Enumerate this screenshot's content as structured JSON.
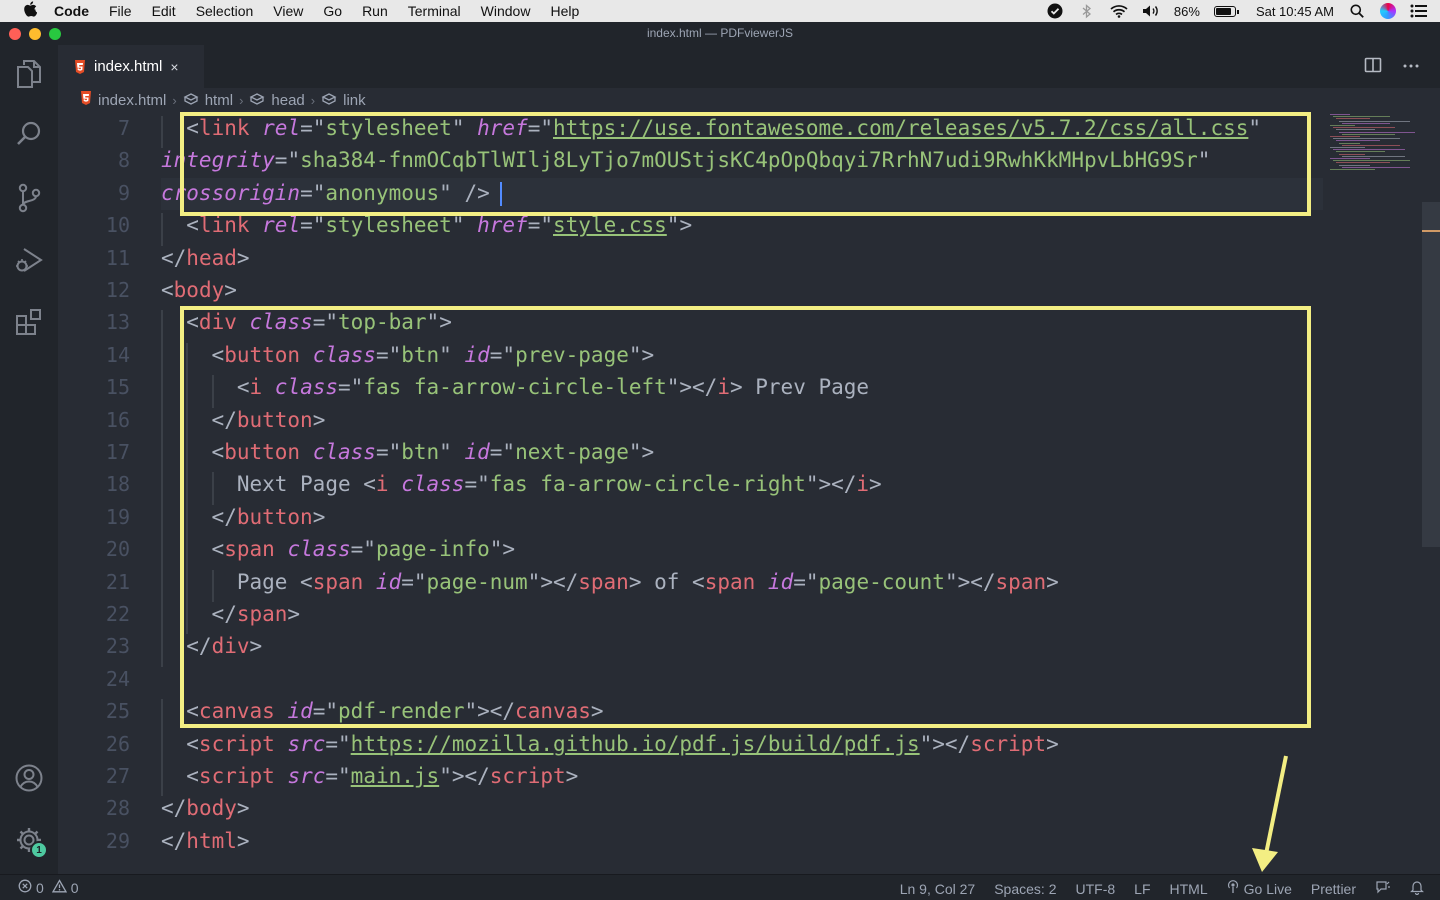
{
  "menubar": {
    "app": "Code",
    "items": [
      "File",
      "Edit",
      "Selection",
      "View",
      "Go",
      "Run",
      "Terminal",
      "Window",
      "Help"
    ],
    "battery": "86%",
    "battery_level": 0.86,
    "clock": "Sat 10:45 AM",
    "icons": [
      "apple-icon",
      "checkmark-circle-icon",
      "bluetooth-icon",
      "wifi-icon",
      "volume-icon",
      "battery-icon",
      "spotlight-search-icon",
      "siri-icon",
      "notification-center-icon"
    ]
  },
  "window": {
    "title": "index.html — PDFviewerJS"
  },
  "activity_bar": {
    "icons": [
      "explorer-icon",
      "search-icon",
      "source-control-icon",
      "run-debug-icon",
      "extensions-icon",
      "accounts-icon",
      "manage-gear-icon"
    ],
    "manage_badge": "1"
  },
  "tab": {
    "label": "index.html",
    "close": "×"
  },
  "breadcrumb": [
    "index.html",
    "html",
    "head",
    "link"
  ],
  "editor": {
    "line_numbers": [
      "7",
      "8",
      "9",
      "10",
      "11",
      "12",
      "13",
      "14",
      "15",
      "16",
      "17",
      "18",
      "19",
      "20",
      "21",
      "22",
      "23",
      "24",
      "25",
      "26",
      "27",
      "28",
      "29"
    ],
    "lines": [
      [
        [
          "p",
          "<"
        ],
        [
          "t",
          "link"
        ],
        [
          "p",
          " "
        ],
        [
          "a",
          "rel"
        ],
        [
          "p",
          "=\""
        ],
        [
          "s",
          "stylesheet"
        ],
        [
          "p",
          "\" "
        ],
        [
          "a",
          "href"
        ],
        [
          "p",
          "=\""
        ],
        [
          "su",
          "https://use.fontawesome.com/releases/v5.7.2/css/all.css"
        ],
        [
          "p",
          "\""
        ]
      ],
      [
        [
          "a",
          "integrity"
        ],
        [
          "p",
          "=\""
        ],
        [
          "s",
          "sha384-fnmOCqbTlWIlj8LyTjo7mOUStjsKC4pOpQbqyi7RrhN7udi9RwhKkMHpvLbHG9Sr"
        ],
        [
          "p",
          "\""
        ]
      ],
      [
        [
          "a",
          "crossorigin"
        ],
        [
          "p",
          "=\""
        ],
        [
          "s",
          "anonymous"
        ],
        [
          "p",
          "\" />"
        ]
      ],
      [
        [
          "p",
          "<"
        ],
        [
          "t",
          "link"
        ],
        [
          "p",
          " "
        ],
        [
          "a",
          "rel"
        ],
        [
          "p",
          "=\""
        ],
        [
          "s",
          "stylesheet"
        ],
        [
          "p",
          "\" "
        ],
        [
          "a",
          "href"
        ],
        [
          "p",
          "=\""
        ],
        [
          "su",
          "style.css"
        ],
        [
          "p",
          "\">"
        ]
      ],
      [
        [
          "p",
          "</"
        ],
        [
          "t",
          "head"
        ],
        [
          "p",
          ">"
        ]
      ],
      [
        [
          "p",
          "<"
        ],
        [
          "t",
          "body"
        ],
        [
          "p",
          ">"
        ]
      ],
      [
        [
          "p",
          "<"
        ],
        [
          "t",
          "div"
        ],
        [
          "p",
          " "
        ],
        [
          "a",
          "class"
        ],
        [
          "p",
          "=\""
        ],
        [
          "s",
          "top-bar"
        ],
        [
          "p",
          "\">"
        ]
      ],
      [
        [
          "p",
          "<"
        ],
        [
          "t",
          "button"
        ],
        [
          "p",
          " "
        ],
        [
          "a",
          "class"
        ],
        [
          "p",
          "=\""
        ],
        [
          "s",
          "btn"
        ],
        [
          "p",
          "\" "
        ],
        [
          "a",
          "id"
        ],
        [
          "p",
          "=\""
        ],
        [
          "s",
          "prev-page"
        ],
        [
          "p",
          "\">"
        ]
      ],
      [
        [
          "p",
          "<"
        ],
        [
          "t",
          "i"
        ],
        [
          "p",
          " "
        ],
        [
          "a",
          "class"
        ],
        [
          "p",
          "=\""
        ],
        [
          "s",
          "fas fa-arrow-circle-left"
        ],
        [
          "p",
          "\"></"
        ],
        [
          "t",
          "i"
        ],
        [
          "p",
          "> Prev Page"
        ]
      ],
      [
        [
          "p",
          "</"
        ],
        [
          "t",
          "button"
        ],
        [
          "p",
          ">"
        ]
      ],
      [
        [
          "p",
          "<"
        ],
        [
          "t",
          "button"
        ],
        [
          "p",
          " "
        ],
        [
          "a",
          "class"
        ],
        [
          "p",
          "=\""
        ],
        [
          "s",
          "btn"
        ],
        [
          "p",
          "\" "
        ],
        [
          "a",
          "id"
        ],
        [
          "p",
          "=\""
        ],
        [
          "s",
          "next-page"
        ],
        [
          "p",
          "\">"
        ]
      ],
      [
        [
          "p",
          "Next Page <"
        ],
        [
          "t",
          "i"
        ],
        [
          "p",
          " "
        ],
        [
          "a",
          "class"
        ],
        [
          "p",
          "=\""
        ],
        [
          "s",
          "fas fa-arrow-circle-right"
        ],
        [
          "p",
          "\"></"
        ],
        [
          "t",
          "i"
        ],
        [
          "p",
          ">"
        ]
      ],
      [
        [
          "p",
          "</"
        ],
        [
          "t",
          "button"
        ],
        [
          "p",
          ">"
        ]
      ],
      [
        [
          "p",
          "<"
        ],
        [
          "t",
          "span"
        ],
        [
          "p",
          " "
        ],
        [
          "a",
          "class"
        ],
        [
          "p",
          "=\""
        ],
        [
          "s",
          "page-info"
        ],
        [
          "p",
          "\">"
        ]
      ],
      [
        [
          "p",
          "Page <"
        ],
        [
          "t",
          "span"
        ],
        [
          "p",
          " "
        ],
        [
          "a",
          "id"
        ],
        [
          "p",
          "=\""
        ],
        [
          "s",
          "page-num"
        ],
        [
          "p",
          "\"></"
        ],
        [
          "t",
          "span"
        ],
        [
          "p",
          "> of <"
        ],
        [
          "t",
          "span"
        ],
        [
          "p",
          " "
        ],
        [
          "a",
          "id"
        ],
        [
          "p",
          "=\""
        ],
        [
          "s",
          "page-count"
        ],
        [
          "p",
          "\"></"
        ],
        [
          "t",
          "span"
        ],
        [
          "p",
          ">"
        ]
      ],
      [
        [
          "p",
          "</"
        ],
        [
          "t",
          "span"
        ],
        [
          "p",
          ">"
        ]
      ],
      [
        [
          "p",
          "</"
        ],
        [
          "t",
          "div"
        ],
        [
          "p",
          ">"
        ]
      ],
      [],
      [
        [
          "p",
          "<"
        ],
        [
          "t",
          "canvas"
        ],
        [
          "p",
          " "
        ],
        [
          "a",
          "id"
        ],
        [
          "p",
          "=\""
        ],
        [
          "s",
          "pdf-render"
        ],
        [
          "p",
          "\"></"
        ],
        [
          "t",
          "canvas"
        ],
        [
          "p",
          ">"
        ]
      ],
      [
        [
          "p",
          "<"
        ],
        [
          "t",
          "script"
        ],
        [
          "p",
          " "
        ],
        [
          "a",
          "src"
        ],
        [
          "p",
          "=\""
        ],
        [
          "su",
          "https://mozilla.github.io/pdf.js/build/pdf.js"
        ],
        [
          "p",
          "\"></"
        ],
        [
          "t",
          "script"
        ],
        [
          "p",
          ">"
        ]
      ],
      [
        [
          "p",
          "<"
        ],
        [
          "t",
          "script"
        ],
        [
          "p",
          " "
        ],
        [
          "a",
          "src"
        ],
        [
          "p",
          "=\""
        ],
        [
          "su",
          "main.js"
        ],
        [
          "p",
          "\"></"
        ],
        [
          "t",
          "script"
        ],
        [
          "p",
          ">"
        ]
      ],
      [
        [
          "p",
          "</"
        ],
        [
          "t",
          "body"
        ],
        [
          "p",
          ">"
        ]
      ],
      [
        [
          "p",
          "</"
        ],
        [
          "t",
          "html"
        ],
        [
          "p",
          ">"
        ]
      ]
    ],
    "indent_levels": [
      1,
      0,
      0,
      1,
      0,
      0,
      1,
      2,
      3,
      2,
      2,
      3,
      2,
      2,
      3,
      2,
      1,
      0,
      1,
      1,
      1,
      0,
      0
    ]
  },
  "statusbar": {
    "errors": "0",
    "warnings": "0",
    "position": "Ln 9, Col 27",
    "spaces": "Spaces: 2",
    "encoding": "UTF-8",
    "eol": "LF",
    "language": "HTML",
    "go_live": "Go Live",
    "formatter": "Prettier"
  }
}
